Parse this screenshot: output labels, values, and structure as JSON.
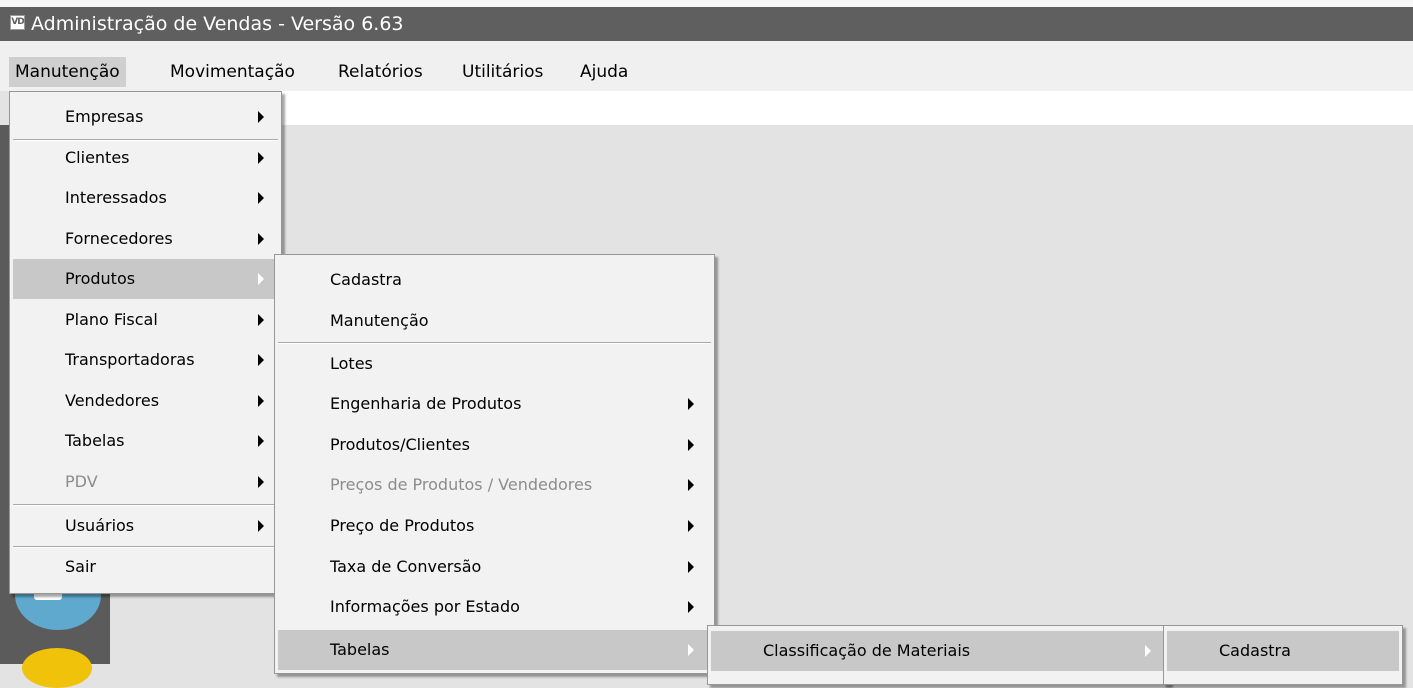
{
  "window": {
    "icon_text": "VD",
    "title": "Administração de Vendas - Versão 6.63"
  },
  "menubar": [
    "Manutenção",
    "Movimentação",
    "Relatórios",
    "Utilitários",
    "Ajuda"
  ],
  "menu_manutencao": [
    "Empresas",
    "Clientes",
    "Interessados",
    "Fornecedores",
    "Produtos",
    "Plano Fiscal",
    "Transportadoras",
    "Vendedores",
    "Tabelas",
    "PDV",
    "Usuários",
    "Sair"
  ],
  "menu_produtos": [
    "Cadastra",
    "Manutenção",
    "Lotes",
    "Engenharia de Produtos",
    "Produtos/Clientes",
    "Preços de Produtos / Vendedores",
    "Preço de Produtos",
    "Taxa de Conversão",
    "Informações por Estado",
    "Tabelas"
  ],
  "menu_tabelas": [
    "Classificação de Materiais"
  ],
  "menu_classificacao": [
    "Cadastra"
  ]
}
